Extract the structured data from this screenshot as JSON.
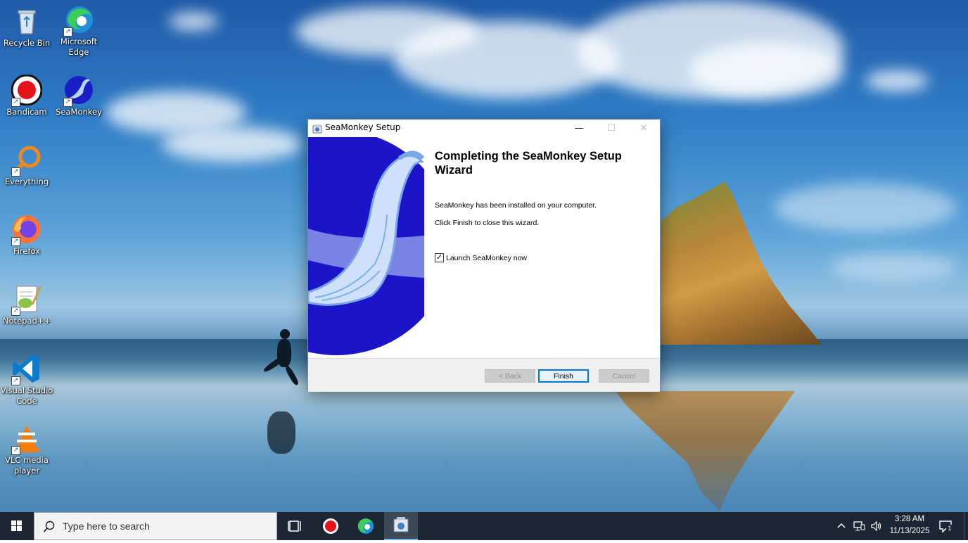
{
  "desktop": {
    "icons": [
      {
        "label": "Recycle Bin",
        "icon": "recycle-bin-icon"
      },
      {
        "label": "Microsoft Edge",
        "icon": "edge-icon"
      },
      {
        "label": "Bandicam",
        "icon": "bandicam-icon"
      },
      {
        "label": "SeaMonkey",
        "icon": "seamonkey-icon"
      },
      {
        "label": "Everything",
        "icon": "everything-icon"
      },
      {
        "label": "Firefox",
        "icon": "firefox-icon"
      },
      {
        "label": "Notepad++",
        "icon": "notepadpp-icon"
      },
      {
        "label": "Visual Studio Code",
        "icon": "vscode-icon"
      },
      {
        "label": "VLC media player",
        "icon": "vlc-icon"
      }
    ]
  },
  "window": {
    "title": "SeaMonkey Setup",
    "heading": "Completing the SeaMonkey Setup Wizard",
    "installed_text": "SeaMonkey has been installed on your computer.",
    "close_text": "Click Finish to close this wizard.",
    "launch_checkbox": {
      "label": "Launch SeaMonkey now",
      "checked": true
    },
    "buttons": {
      "back": "< Back",
      "finish": "Finish",
      "cancel": "Cancel"
    },
    "controls": {
      "minimize": "—",
      "maximize": "☐",
      "close": "✕"
    }
  },
  "taskbar": {
    "search_placeholder": "Type here to search",
    "pinned": [
      "task-view-icon",
      "bandicam-icon",
      "edge-icon",
      "seamonkey-setup-icon"
    ],
    "time": "3:28 AM",
    "date": "11/13/2025",
    "notification_count": "1"
  },
  "colors": {
    "taskbar": "#1c2733",
    "accent": "#0078d7",
    "banner": "#1b14c9"
  }
}
